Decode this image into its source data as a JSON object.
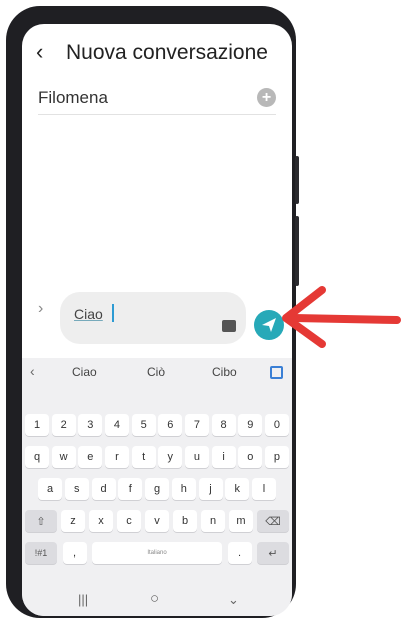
{
  "header": {
    "back_icon": "chevron-left-icon",
    "title": "Nuova conversazione"
  },
  "recipient": {
    "name": "Filomena",
    "add_icon": "add-circle-icon"
  },
  "composer": {
    "expand_icon": "chevron-right-icon",
    "text": "Ciao",
    "sticker_icon": "sticker-icon",
    "send_icon": "send-icon",
    "send_color": "#27a9b8"
  },
  "keyboard": {
    "suggestions": [
      "Ciao",
      "Ciò",
      "Cibo"
    ],
    "numbers": [
      "1",
      "2",
      "3",
      "4",
      "5",
      "6",
      "7",
      "8",
      "9",
      "0"
    ],
    "row1": [
      "q",
      "w",
      "e",
      "r",
      "t",
      "y",
      "u",
      "i",
      "o",
      "p"
    ],
    "row2": [
      "a",
      "s",
      "d",
      "f",
      "g",
      "h",
      "j",
      "k",
      "l"
    ],
    "row3": [
      "z",
      "x",
      "c",
      "v",
      "b",
      "n",
      "m"
    ],
    "sym_label": "!#1",
    "comma": ",",
    "space_label": "Italiano",
    "period": "."
  },
  "nav": {
    "recents": "|||",
    "home": "○",
    "back": "⌄"
  },
  "annotation": {
    "arrow_color": "#e53935"
  }
}
